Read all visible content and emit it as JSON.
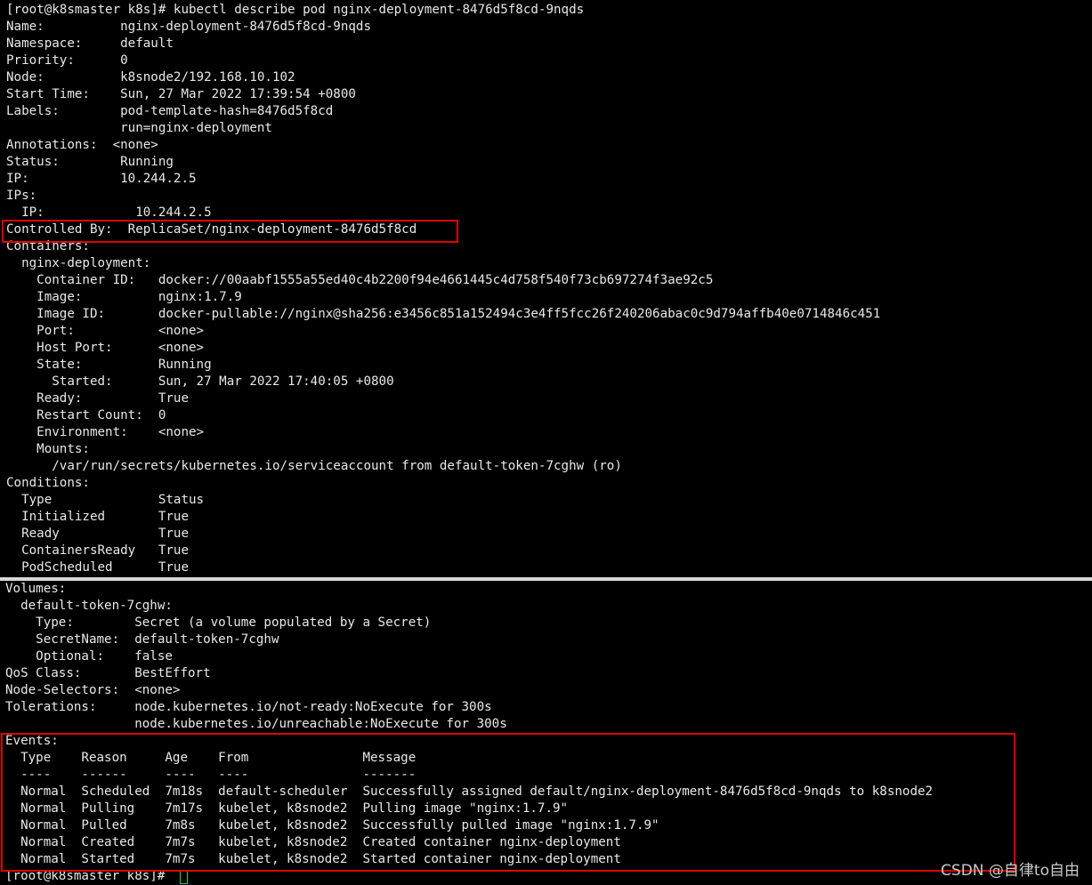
{
  "top_lines": [
    "[root@k8smaster k8s]# kubectl describe pod nginx-deployment-8476d5f8cd-9nqds",
    "Name:          nginx-deployment-8476d5f8cd-9nqds",
    "Namespace:     default",
    "Priority:      0",
    "Node:          k8snode2/192.168.10.102",
    "Start Time:    Sun, 27 Mar 2022 17:39:54 +0800",
    "Labels:        pod-template-hash=8476d5f8cd",
    "               run=nginx-deployment",
    "Annotations:  <none>",
    "Status:        Running",
    "IP:            10.244.2.5",
    "IPs:",
    "  IP:            10.244.2.5",
    "Controlled By:  ReplicaSet/nginx-deployment-8476d5f8cd",
    "Containers:",
    "  nginx-deployment:",
    "    Container ID:   docker://00aabf1555a55ed40c4b2200f94e4661445c4d758f540f73cb697274f3ae92c5",
    "    Image:          nginx:1.7.9",
    "    Image ID:       docker-pullable://nginx@sha256:e3456c851a152494c3e4ff5fcc26f240206abac0c9d794affb40e0714846c451",
    "    Port:           <none>",
    "    Host Port:      <none>",
    "    State:          Running",
    "      Started:      Sun, 27 Mar 2022 17:40:05 +0800",
    "    Ready:          True",
    "    Restart Count:  0",
    "    Environment:    <none>",
    "    Mounts:",
    "      /var/run/secrets/kubernetes.io/serviceaccount from default-token-7cghw (ro)",
    "Conditions:",
    "  Type              Status",
    "  Initialized       True",
    "  Ready             True",
    "  ContainersReady   True",
    "  PodScheduled      True"
  ],
  "bottom_lines": [
    "Volumes:",
    "  default-token-7cghw:",
    "    Type:        Secret (a volume populated by a Secret)",
    "    SecretName:  default-token-7cghw",
    "    Optional:    false",
    "QoS Class:       BestEffort",
    "Node-Selectors:  <none>",
    "Tolerations:     node.kubernetes.io/not-ready:NoExecute for 300s",
    "                 node.kubernetes.io/unreachable:NoExecute for 300s",
    "Events:",
    "  Type    Reason     Age    From               Message",
    "  ----    ------     ----   ----               -------",
    "  Normal  Scheduled  7m18s  default-scheduler  Successfully assigned default/nginx-deployment-8476d5f8cd-9nqds to k8snode2",
    "  Normal  Pulling    7m17s  kubelet, k8snode2  Pulling image \"nginx:1.7.9\"",
    "  Normal  Pulled     7m8s   kubelet, k8snode2  Successfully pulled image \"nginx:1.7.9\"",
    "  Normal  Created    7m7s   kubelet, k8snode2  Created container nginx-deployment",
    "  Normal  Started    7m7s   kubelet, k8snode2  Started container nginx-deployment",
    "[root@k8smaster k8s]# "
  ],
  "watermark": "CSDN @自律to自由",
  "colors": {
    "background": "#000000",
    "text": "#e8e8e8",
    "highlight": "#e00000",
    "cursor": "#2ecc40"
  }
}
